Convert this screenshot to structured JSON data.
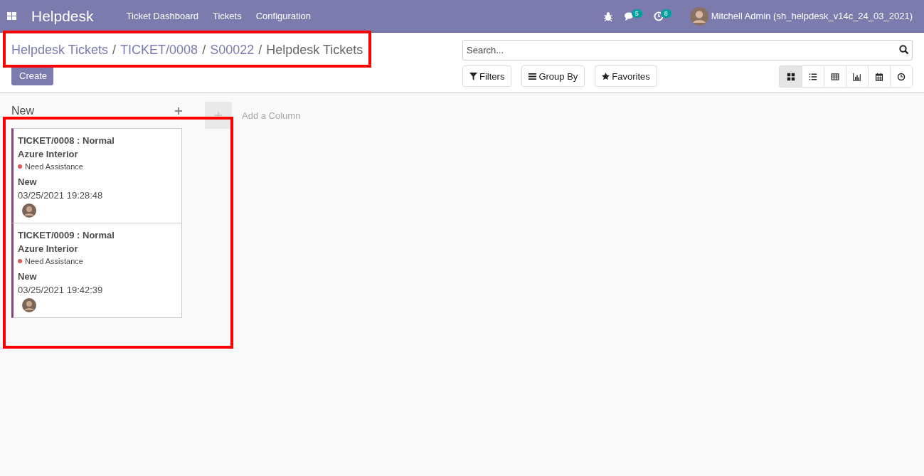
{
  "navbar": {
    "app_name": "Helpdesk",
    "menu": [
      "Ticket Dashboard",
      "Tickets",
      "Configuration"
    ],
    "messages_count": "5",
    "activities_count": "8",
    "user": "Mitchell Admin (sh_helpdesk_v14c_24_03_2021)"
  },
  "breadcrumbs": [
    "Helpdesk Tickets",
    "TICKET/0008",
    "S00022",
    "Helpdesk Tickets"
  ],
  "breadcrumb_separator": "/",
  "create_button": "Create",
  "search": {
    "placeholder": "Search..."
  },
  "filter_buttons": [
    {
      "kind": "filter",
      "label": "Filters"
    },
    {
      "kind": "group",
      "label": "Group By"
    },
    {
      "kind": "favorite",
      "label": "Favorites"
    }
  ],
  "views": [
    {
      "kind": "kanban",
      "selected": true
    },
    {
      "kind": "list",
      "selected": false
    },
    {
      "kind": "pivot",
      "selected": false
    },
    {
      "kind": "graph",
      "selected": false
    },
    {
      "kind": "calendar",
      "selected": false
    },
    {
      "kind": "activity",
      "selected": false
    }
  ],
  "columns": [
    {
      "title": "New",
      "cards": [
        {
          "title": "TICKET/0008 : Normal",
          "customer": "Azure Interior",
          "tag": {
            "label": "Need Assistance",
            "color": "#e05a5a"
          },
          "stage": "New",
          "date": "03/25/2021 19:28:48"
        },
        {
          "title": "TICKET/0009 : Normal",
          "customer": "Azure Interior",
          "tag": {
            "label": "Need Assistance",
            "color": "#e05a5a"
          },
          "stage": "New",
          "date": "03/25/2021 19:42:39"
        }
      ]
    }
  ],
  "add_column": "Add a Column"
}
